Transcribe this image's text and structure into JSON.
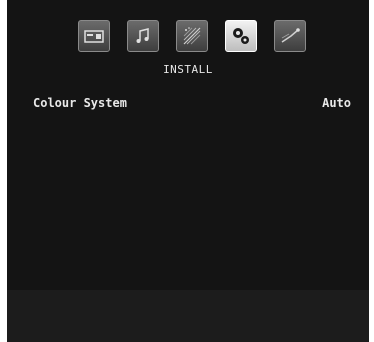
{
  "menu": {
    "title": "INSTALL",
    "tabs": [
      {
        "icon": "picture-icon",
        "active": false
      },
      {
        "icon": "sound-icon",
        "active": false
      },
      {
        "icon": "feature-icon",
        "active": false
      },
      {
        "icon": "install-icon",
        "active": true
      },
      {
        "icon": "source-icon",
        "active": false
      }
    ]
  },
  "settings": [
    {
      "label": "Colour System",
      "value": "Auto"
    }
  ],
  "colors": {
    "background": "#141414",
    "text": "#e8e8e8",
    "tab_inactive": "#5a5a5a",
    "tab_active": "#e0e0e0"
  }
}
